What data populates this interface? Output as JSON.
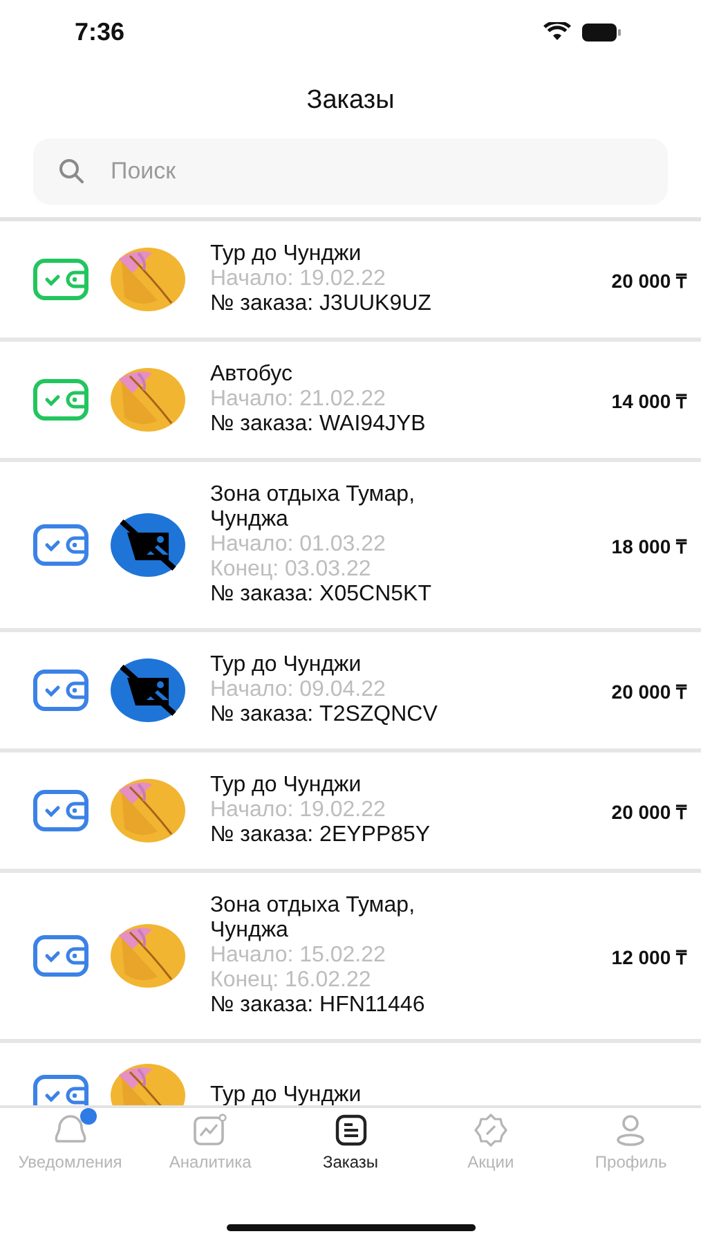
{
  "status_bar": {
    "time": "7:36"
  },
  "title": "Заказы",
  "search": {
    "placeholder": "Поиск"
  },
  "orders": [
    {
      "color": "#22c55e",
      "thumb": {
        "kind": "picture"
      },
      "name": "Тур до Чунджи",
      "dates": [
        "Начало: 19.02.22"
      ],
      "number": "№ заказа: J3UUK9UZ",
      "price": "20 000 ₸"
    },
    {
      "color": "#22c55e",
      "thumb": {
        "kind": "picture"
      },
      "name": "Автобус",
      "dates": [
        "Начало: 21.02.22"
      ],
      "number": "№ заказа: WAI94JYB",
      "price": "14 000 ₸"
    },
    {
      "color": "#3b82e6",
      "thumb": {
        "kind": "no-image"
      },
      "name": "Зона отдыха Тумар, Чунджа",
      "dates": [
        "Начало: 01.03.22",
        "Конец: 03.03.22"
      ],
      "number": "№ заказа: X05CN5KT",
      "price": "18 000 ₸"
    },
    {
      "color": "#3b82e6",
      "thumb": {
        "kind": "no-image"
      },
      "name": "Тур до Чунджи",
      "dates": [
        "Начало: 09.04.22"
      ],
      "number": "№ заказа: T2SZQNCV",
      "price": "20 000 ₸"
    },
    {
      "color": "#3b82e6",
      "thumb": {
        "kind": "picture"
      },
      "name": "Тур до Чунджи",
      "dates": [
        "Начало: 19.02.22"
      ],
      "number": "№ заказа: 2EYPP85Y",
      "price": "20 000 ₸"
    },
    {
      "color": "#3b82e6",
      "thumb": {
        "kind": "picture"
      },
      "name": "Зона отдыха Тумар, Чунджа",
      "dates": [
        "Начало: 15.02.22",
        "Конец: 16.02.22"
      ],
      "number": "№ заказа: HFN11446",
      "price": "12 000 ₸"
    },
    {
      "color": "#3b82e6",
      "thumb": {
        "kind": "picture"
      },
      "name": "Тур до Чунджи"
    }
  ],
  "tabs": [
    {
      "kind": "bell",
      "label": "Уведомления",
      "selected": false,
      "badge": true
    },
    {
      "kind": "chart",
      "label": "Аналитика",
      "selected": false,
      "badge": false
    },
    {
      "kind": "list",
      "label": "Заказы",
      "selected": true,
      "badge": false
    },
    {
      "kind": "discount",
      "label": "Акции",
      "selected": false,
      "badge": false
    },
    {
      "kind": "person",
      "label": "Профиль",
      "selected": false,
      "badge": false
    }
  ]
}
